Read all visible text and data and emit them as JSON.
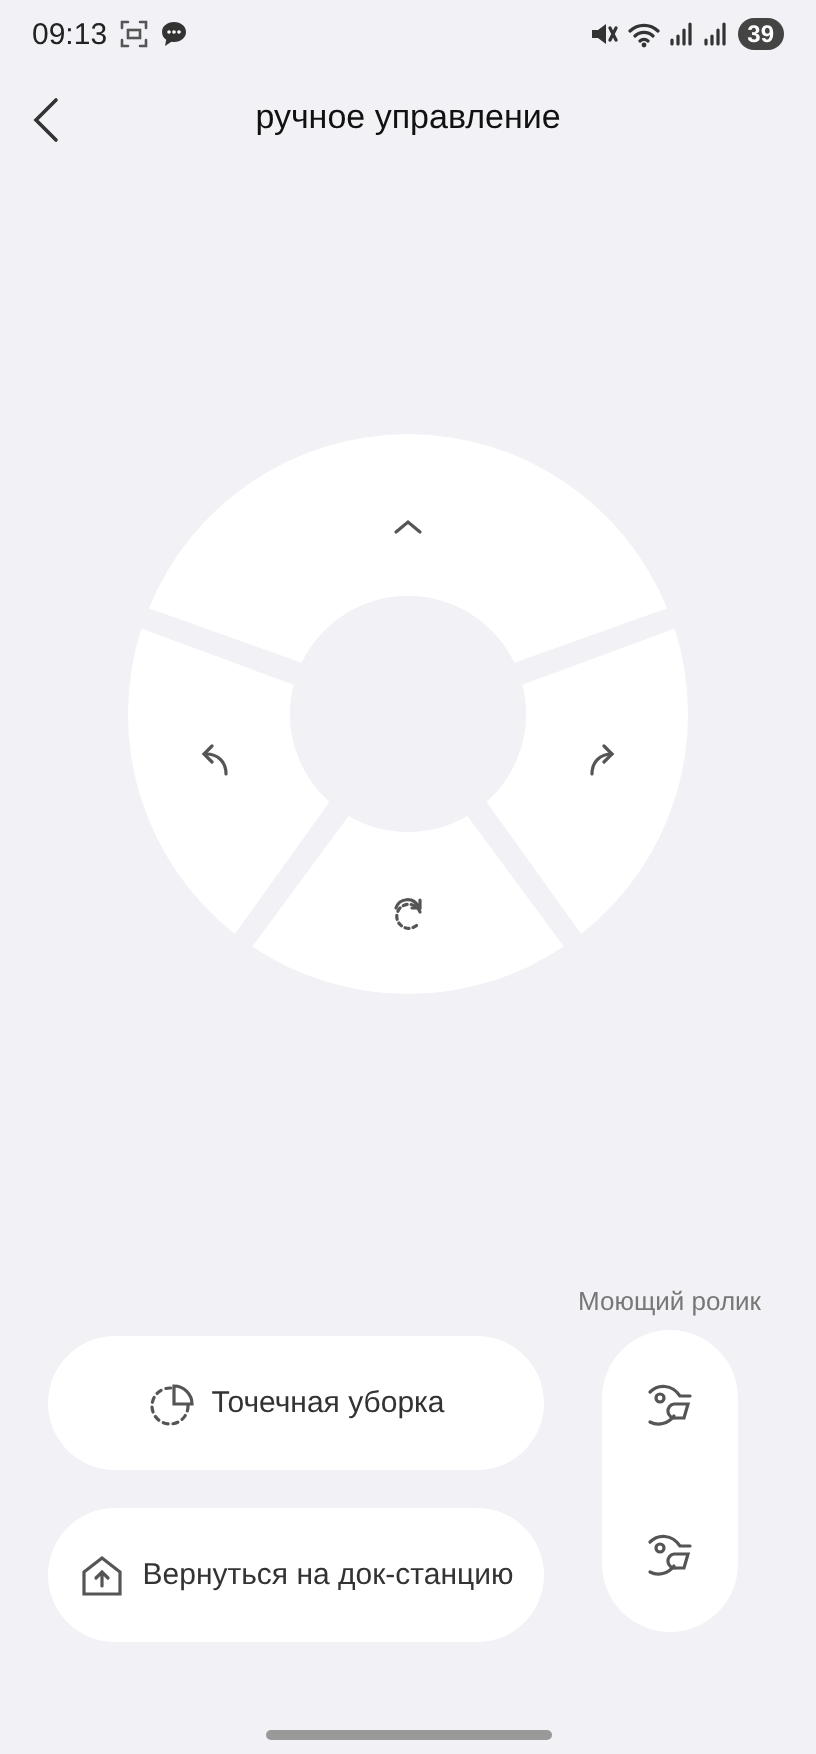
{
  "status_bar": {
    "time": "09:13",
    "battery": "39"
  },
  "header": {
    "title": "ручное управление"
  },
  "controls": {
    "label": "Моющий ролик"
  },
  "actions": [
    {
      "kind": "spot",
      "label": "Точечная уборка"
    },
    {
      "kind": "dock",
      "label": "Вернуться на док-станцию"
    }
  ]
}
